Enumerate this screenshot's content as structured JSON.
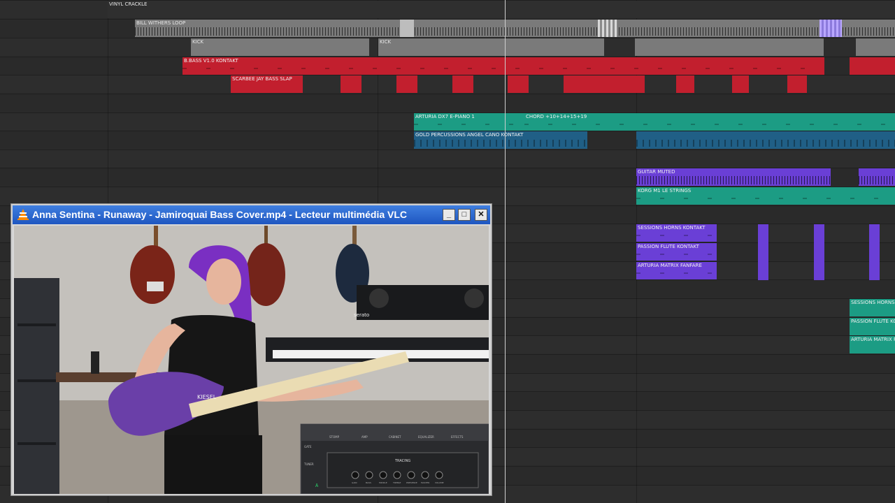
{
  "colors": {
    "gray_clip": "#7c7c7c",
    "red_clip": "#c21f2e",
    "teal_clip": "#1c9c84",
    "blue_clip": "#205f86",
    "purple_clip": "#6a3fd6",
    "vlc_title_bar": "#1e56c0"
  },
  "tracks": [
    {
      "clips": [
        {
          "label": "VINYL CRACKLE",
          "color": "gray"
        }
      ]
    },
    {
      "clips": [
        {
          "label": "BILL WITHERS LOOP",
          "color": "gray"
        }
      ]
    },
    {
      "clips": [
        {
          "label": "KICK",
          "color": "gray"
        },
        {
          "label": "KICK",
          "color": "gray"
        }
      ]
    },
    {
      "clips": [
        {
          "label": "B.BASS V1.0 KONTAKT",
          "color": "red"
        }
      ]
    },
    {
      "clips": [
        {
          "label": "SCARBEE JAY BASS SLAP",
          "color": "red"
        }
      ]
    },
    {
      "clips": [
        {
          "label": "ARTURIA DX7 E-PIANO 1",
          "color": "teal"
        },
        {
          "label": "CHORD +10+14+15+19",
          "color": "teal"
        }
      ]
    },
    {
      "clips": [
        {
          "label": "GOLD PERCUSSIONS ANGEL CANO KONTAKT",
          "color": "blue"
        }
      ]
    },
    {
      "clips": [
        {
          "label": "GUITAR MUTED",
          "color": "purple"
        }
      ]
    },
    {
      "clips": [
        {
          "label": "KORG M1 LE STRINGS",
          "color": "teal"
        }
      ]
    },
    {
      "clips": [
        {
          "label": "SESSIONS HORNS KONTAKT",
          "color": "purple"
        }
      ]
    },
    {
      "clips": [
        {
          "label": "PASSION FLUTE KONTAKT",
          "color": "purple"
        }
      ]
    },
    {
      "clips": [
        {
          "label": "ARTURIA MATRIX FANFARE",
          "color": "purple"
        }
      ]
    },
    {
      "clips": [
        {
          "label": "SESSIONS HORNS",
          "color": "teal"
        }
      ]
    },
    {
      "clips": [
        {
          "label": "PASSION FLUTE KO",
          "color": "teal"
        }
      ]
    },
    {
      "clips": [
        {
          "label": "ARTURIA MATRIX F",
          "color": "teal"
        }
      ]
    }
  ],
  "vlc": {
    "title": "Anna Sentina - Runaway - Jamiroquai Bass Cover.mp4 - Lecteur multimédia VLC",
    "minimize_icon": "minimize-icon",
    "maximize_icon": "maximize-icon",
    "close_icon": "close-icon",
    "video": {
      "bass_brand": "KIESEL",
      "controller_brand": "serato",
      "amp_brand": "TRACING",
      "plugin_tabs": [
        "STOMP",
        "AMP",
        "CABINET",
        "EQUALIZER",
        "EFFECTS"
      ],
      "plugin_side_labels": [
        "GATE",
        "TUNER"
      ],
      "tuner_note": "A",
      "amp_knob_labels": [
        "GAIN",
        "BASS",
        "MIDDLE",
        "TREBLE",
        "PRESENCE",
        "MASTER",
        "VOLUME"
      ]
    }
  }
}
